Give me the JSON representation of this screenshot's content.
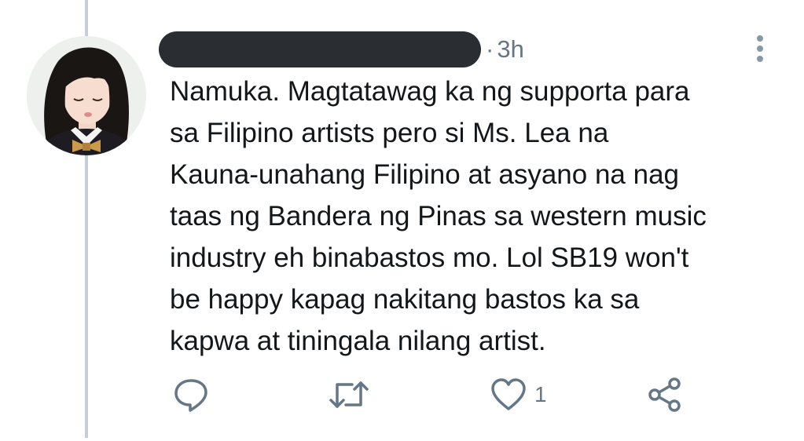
{
  "tweet": {
    "author_redacted": true,
    "separator": "·",
    "time": "3h",
    "text_lines": [
      "Namuka. Magtatawag ka ng supporta para",
      "sa Filipino artists pero si Ms. Lea na",
      "Kauna-unahang Filipino at asyano na nag",
      "taas ng Bandera ng Pinas sa western music",
      "industry eh binabastos mo. Lol SB19 won't",
      "be happy kapag nakitang bastos ka sa",
      "kapwa at tiningala nilang artist."
    ]
  },
  "actions": {
    "reply_icon": "reply-icon",
    "retweet_icon": "retweet-icon",
    "like_icon": "heart-icon",
    "like_count": "1",
    "share_icon": "share-icon"
  },
  "colors": {
    "text": "#14171a",
    "muted": "#657786",
    "thread_line": "#c4cfd6",
    "redaction": "#2a2e33"
  }
}
